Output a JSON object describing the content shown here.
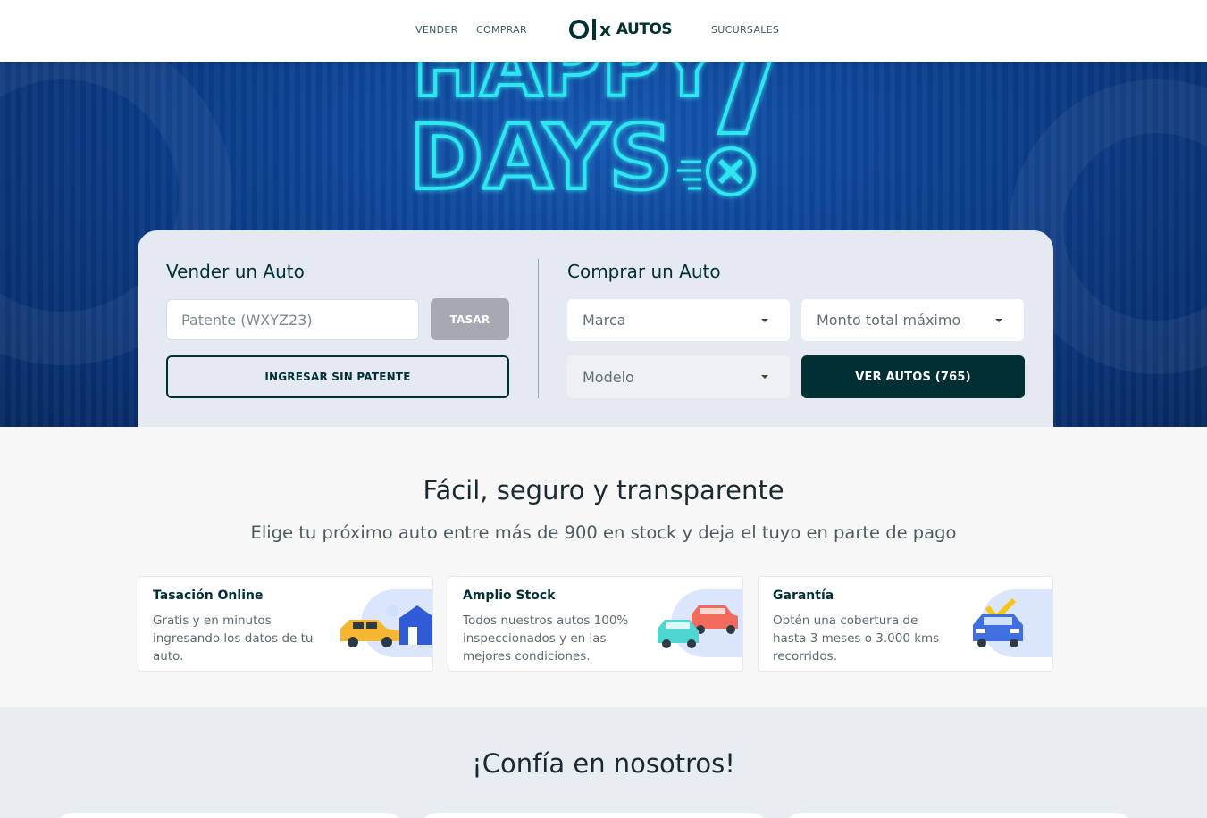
{
  "nav": {
    "sell": "VENDER",
    "buy": "COMPRAR",
    "logo_text": "AUTOS",
    "branches": "SUCURSALES"
  },
  "hero": {
    "banner_text": "HAPPY DAYS !"
  },
  "sell": {
    "title": "Vender un Auto",
    "plate_placeholder": "Patente (WXYZ23)",
    "appraise_button": "TASAR",
    "no_plate_button": "INGRESAR SIN PATENTE"
  },
  "buy": {
    "title": "Comprar un Auto",
    "brand_select": "Marca",
    "max_amount_select": "Monto total máximo",
    "model_select": "Modelo",
    "see_cars_button": "VER AUTOS (765)"
  },
  "features": {
    "title": "Fácil, seguro y transparente",
    "subtitle": "Elige tu próximo auto entre más de 900 en stock y deja el tuyo en parte de pago",
    "items": [
      {
        "title": "Tasación Online",
        "description": "Gratis y en minutos ingresando los datos de tu auto."
      },
      {
        "title": "Amplio Stock",
        "description": "Todos nuestros autos 100% inspeccionados y en las mejores condiciones."
      },
      {
        "title": "Garantía",
        "description": "Obtén una cobertura de hasta 3 meses o 3.000 kms recorridos."
      }
    ]
  },
  "trust": {
    "title": "¡Confía en nosotros!"
  },
  "colors": {
    "brand_dark": "#002f34",
    "hero_blue": "#0b3e8c",
    "neon": "#2fe6f0",
    "disabled_button": "#a5a9b1"
  }
}
